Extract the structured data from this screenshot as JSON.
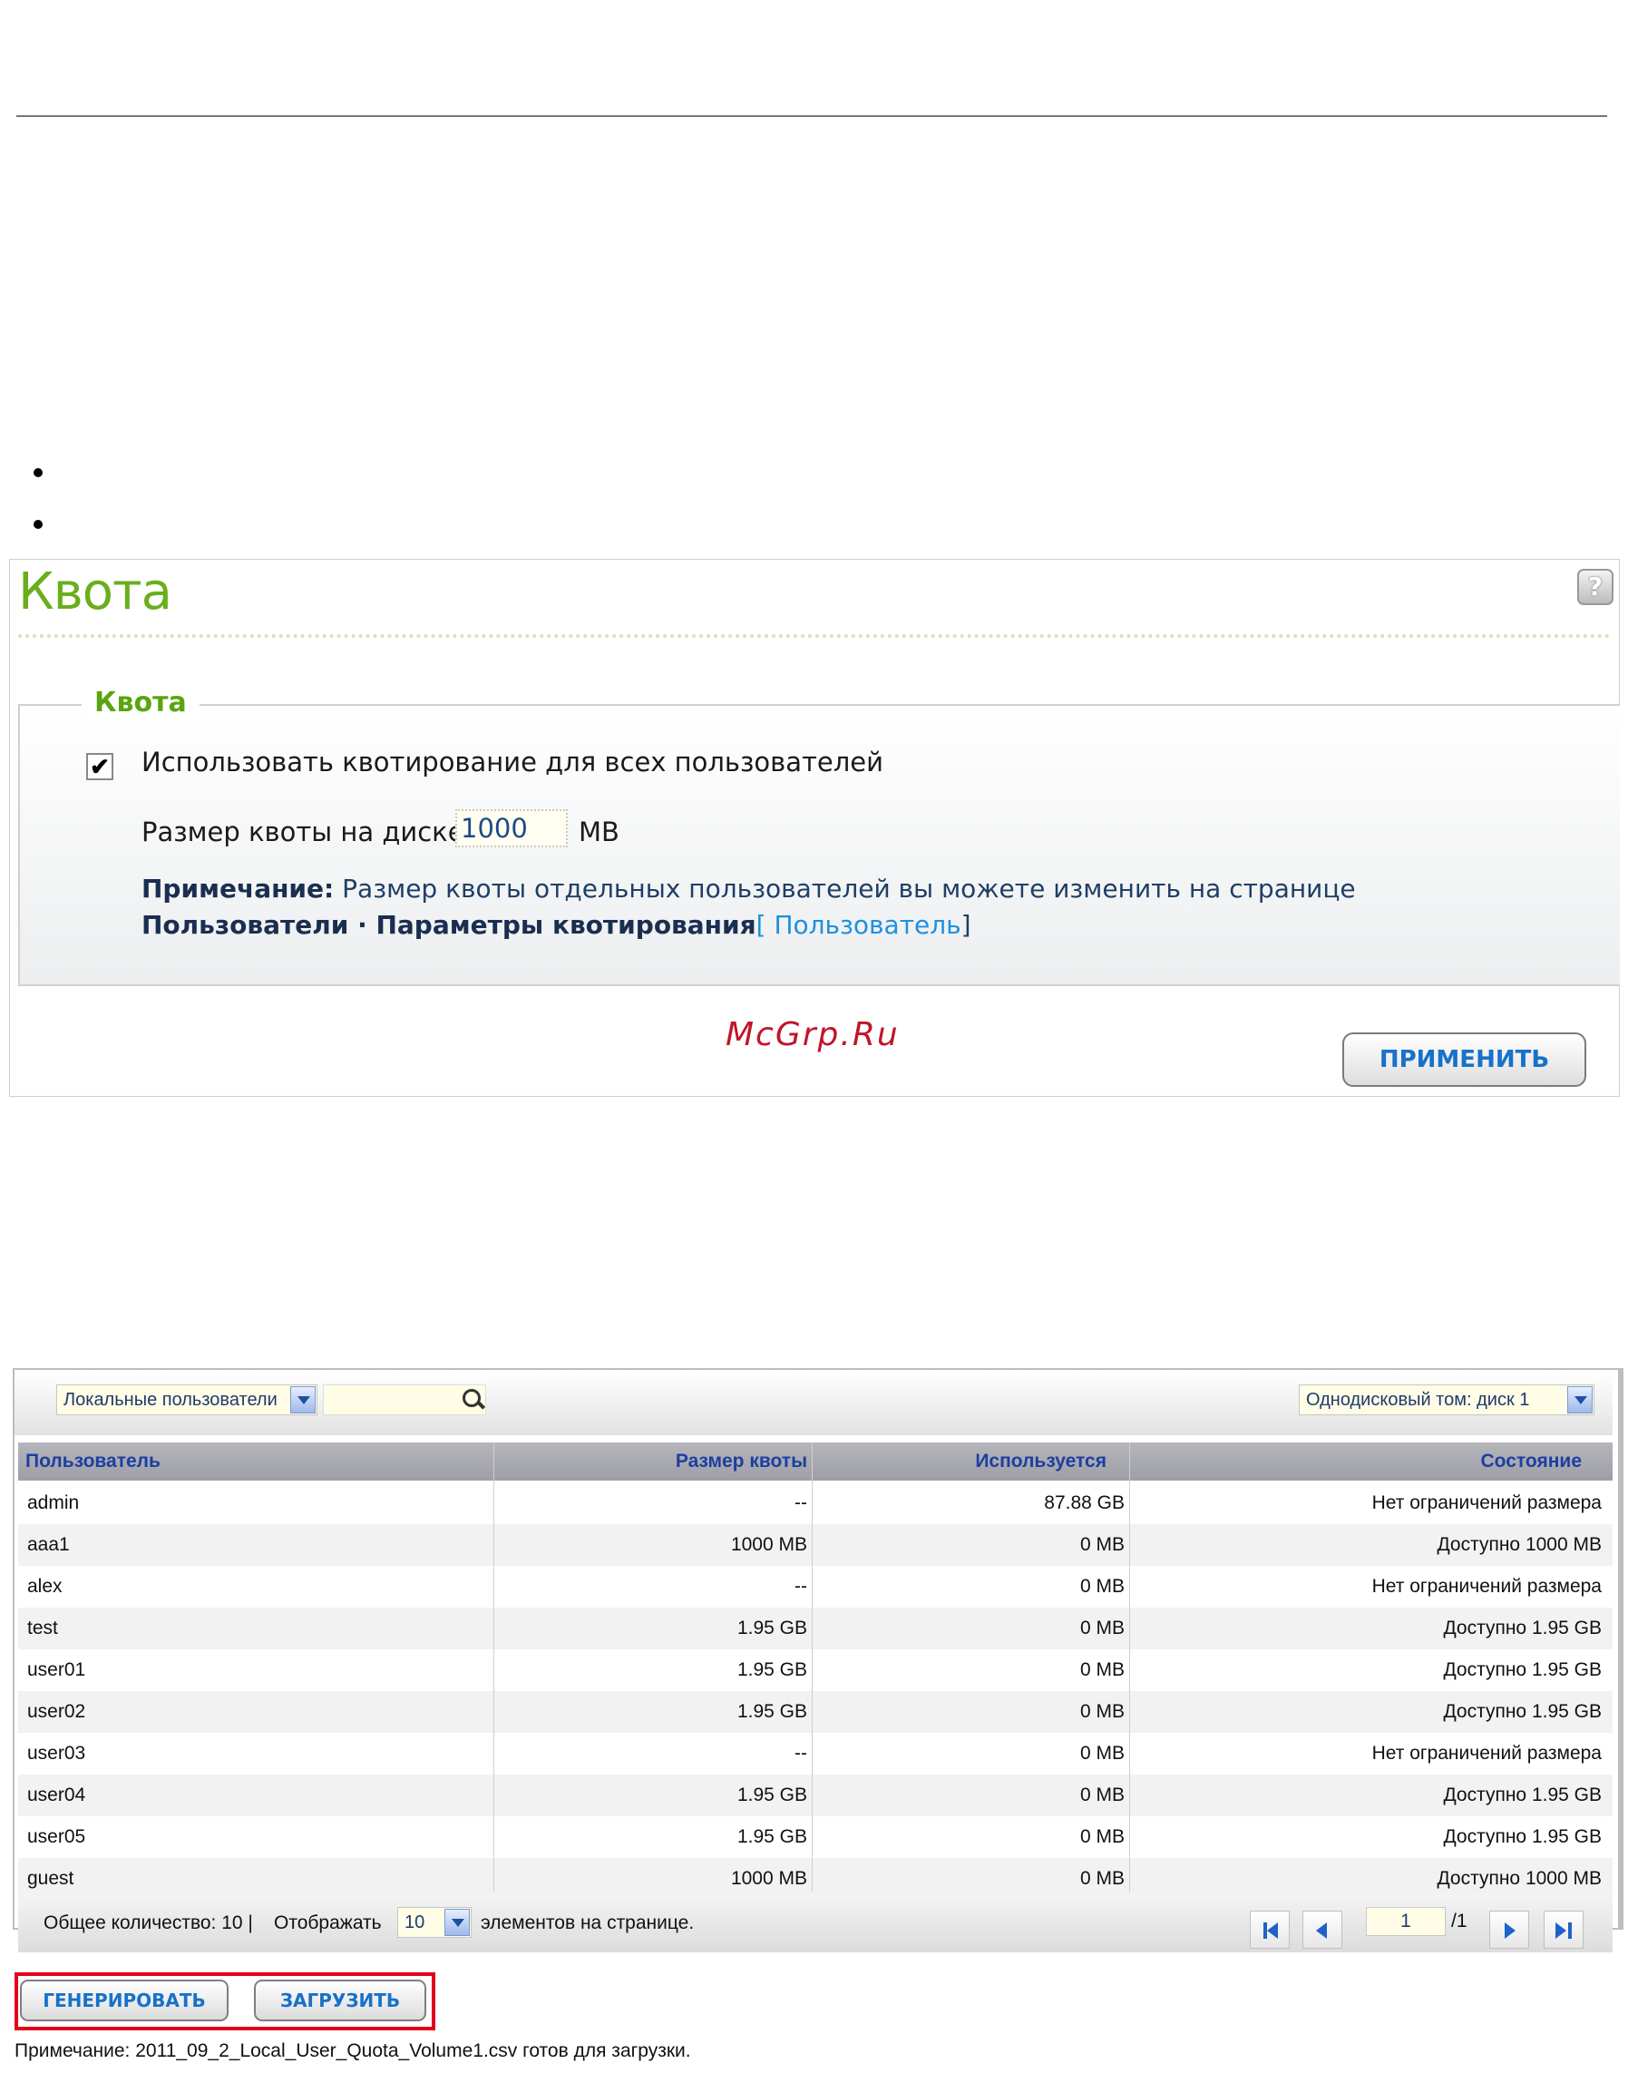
{
  "quota_panel": {
    "title": "Квота",
    "section_legend": "Квота",
    "enable_label": "Использовать квотирование для всех пользователей",
    "enable_checked": true,
    "size_label": "Размер квоты на диске:",
    "size_value": "1000",
    "size_unit": "MB",
    "note_bold": "Примечание:",
    "note_text": " Размер квоты отдельных пользователей вы можете изменить на странице ",
    "note_bold2": "Пользователи · Параметры квотирования",
    "note_link_open": "[ ",
    "note_link": "Пользователь",
    "note_link_close": "]",
    "watermark": "McGrp.Ru",
    "apply_label": "ПРИМЕНИТЬ"
  },
  "table_panel": {
    "user_filter": "Локальные пользователи",
    "volume_select": "Однодисковый том: диск 1",
    "columns": [
      "Пользователь",
      "Размер квоты",
      "Используется",
      "Состояние"
    ],
    "rows": [
      [
        "admin",
        "--",
        "87.88 GB",
        "Нет ограничений размера"
      ],
      [
        "aaa1",
        "1000 MB",
        "0 MB",
        "Доступно 1000 MB"
      ],
      [
        "alex",
        "--",
        "0 MB",
        "Нет ограничений размера"
      ],
      [
        "test",
        "1.95 GB",
        "0 MB",
        "Доступно 1.95 GB"
      ],
      [
        "user01",
        "1.95 GB",
        "0 MB",
        "Доступно 1.95 GB"
      ],
      [
        "user02",
        "1.95 GB",
        "0 MB",
        "Доступно 1.95 GB"
      ],
      [
        "user03",
        "--",
        "0 MB",
        "Нет ограничений размера"
      ],
      [
        "user04",
        "1.95 GB",
        "0 MB",
        "Доступно 1.95 GB"
      ],
      [
        "user05",
        "1.95 GB",
        "0 MB",
        "Доступно 1.95 GB"
      ],
      [
        "guest",
        "1000 MB",
        "0 MB",
        "Доступно 1000 MB"
      ]
    ],
    "footer": {
      "total_label": "Общее количество: 10 |",
      "display_label": "Отображать",
      "per_page": "10",
      "per_page_suffix": "элементов на странице.",
      "page": "1",
      "pages": "/1"
    },
    "generate_label": "ГЕНЕРИРОВАТЬ",
    "download_label": "ЗАГРУЗИТЬ",
    "csv_note": "Примечание: 2011_09_2_Local_User_Quota_Volume1.csv  готов для загрузки."
  },
  "colors": {
    "title_green": "#6aae1c",
    "link_blue": "#1772c8",
    "header_text": "#1c3fa0",
    "highlight_red": "#e3001b"
  },
  "icons": [
    "help-icon",
    "checkbox-checked-icon",
    "search-icon",
    "dropdown-arrow-icon",
    "first-page-icon",
    "prev-page-icon",
    "next-page-icon",
    "last-page-icon"
  ]
}
